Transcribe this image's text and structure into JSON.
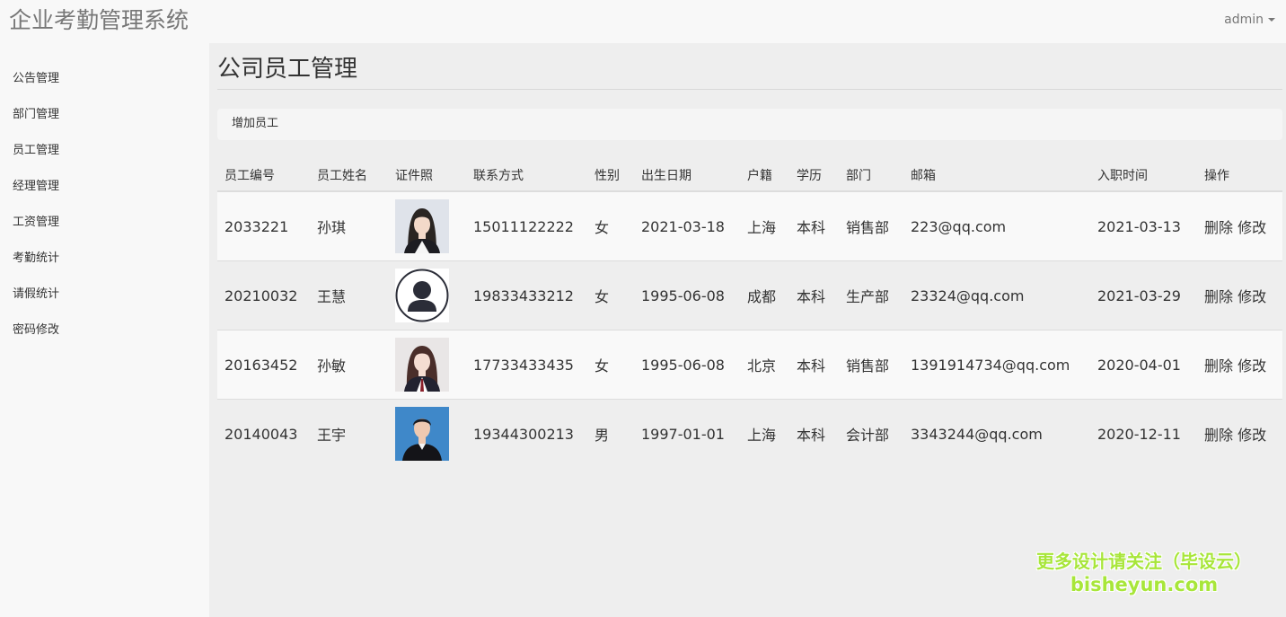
{
  "app": {
    "title": "企业考勤管理系统",
    "user": "admin"
  },
  "sidebar": {
    "items": [
      {
        "label": "公告管理"
      },
      {
        "label": "部门管理"
      },
      {
        "label": "员工管理"
      },
      {
        "label": "经理管理"
      },
      {
        "label": "工资管理"
      },
      {
        "label": "考勤统计"
      },
      {
        "label": "请假统计"
      },
      {
        "label": "密码修改"
      }
    ]
  },
  "main": {
    "page_title": "公司员工管理",
    "add_label": "增加员工",
    "columns": [
      "员工编号",
      "员工姓名",
      "证件照",
      "联系方式",
      "性别",
      "出生日期",
      "户籍",
      "学历",
      "部门",
      "邮箱",
      "入职时间",
      "操作"
    ],
    "rows": [
      {
        "id": "2033221",
        "name": "孙琪",
        "photo": "female-portrait-photo",
        "phone": "15011122222",
        "gender": "女",
        "birth": "2021-03-18",
        "hukou": "上海",
        "edu": "本科",
        "dept": "销售部",
        "email": "223@qq.com",
        "hire": "2021-03-13",
        "delete": "删除",
        "edit": "修改"
      },
      {
        "id": "20210032",
        "name": "王慧",
        "photo": "default-avatar-icon",
        "phone": "19833433212",
        "gender": "女",
        "birth": "1995-06-08",
        "hukou": "成都",
        "edu": "本科",
        "dept": "生产部",
        "email": "23324@qq.com",
        "hire": "2021-03-29",
        "delete": "删除",
        "edit": "修改"
      },
      {
        "id": "20163452",
        "name": "孙敏",
        "photo": "female-portrait-photo",
        "phone": "17733433435",
        "gender": "女",
        "birth": "1995-06-08",
        "hukou": "北京",
        "edu": "本科",
        "dept": "销售部",
        "email": "1391914734@qq.com",
        "hire": "2020-04-01",
        "delete": "删除",
        "edit": "修改"
      },
      {
        "id": "20140043",
        "name": "王宇",
        "photo": "male-portrait-photo",
        "phone": "19344300213",
        "gender": "男",
        "birth": "1997-01-01",
        "hukou": "上海",
        "edu": "本科",
        "dept": "会计部",
        "email": "3343244@qq.com",
        "hire": "2020-12-11",
        "delete": "删除",
        "edit": "修改"
      }
    ]
  },
  "watermark": {
    "line1": "更多设计请关注（毕设云）",
    "line2": "bisheyun.com",
    "color": "#a8e63a"
  }
}
